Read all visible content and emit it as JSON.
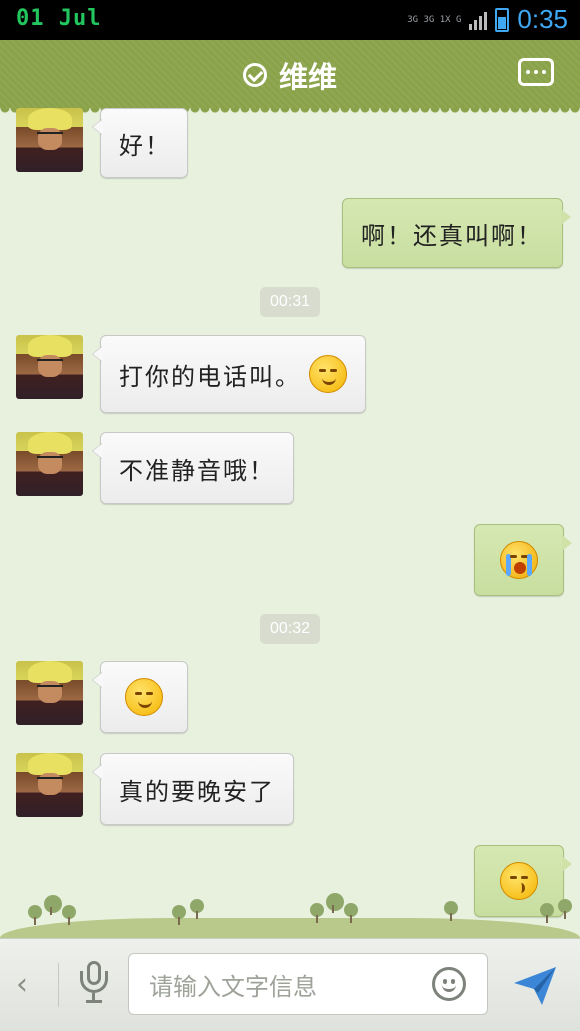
{
  "statusbar": {
    "date": "01 Jul",
    "network": "3G 3G 1X G",
    "time": "0:35"
  },
  "header": {
    "title": "维维",
    "more_icon": "more-options-icon",
    "verified_icon": "check-circle-icon"
  },
  "colors": {
    "header": "#8aa34a",
    "outgoing_bubble": "#cfe3a8",
    "incoming_bubble": "#f4f4f4",
    "background": "#e8f1de",
    "accent": "#3fa9f5"
  },
  "messages": [
    {
      "side": "in",
      "text": "好！"
    },
    {
      "side": "out",
      "text": "啊！还真叫啊！"
    },
    {
      "type": "time",
      "text": "00:31"
    },
    {
      "side": "in",
      "text": "打你的电话叫。",
      "emoji": "grin-emoji"
    },
    {
      "side": "in",
      "text": "不准静音哦！"
    },
    {
      "side": "out",
      "text": "",
      "emoji": "cry-emoji"
    },
    {
      "type": "time",
      "text": "00:32"
    },
    {
      "side": "in",
      "text": "",
      "emoji": "shy-emoji"
    },
    {
      "side": "in",
      "text": "真的要晚安了"
    },
    {
      "side": "out",
      "text": "",
      "emoji": "kiss-emoji"
    }
  ],
  "input": {
    "placeholder": "请输入文字信息",
    "voice_icon": "microphone-icon",
    "emoji_icon": "smiley-icon",
    "send_icon": "send-icon",
    "back_icon": "back-arrow-icon"
  }
}
